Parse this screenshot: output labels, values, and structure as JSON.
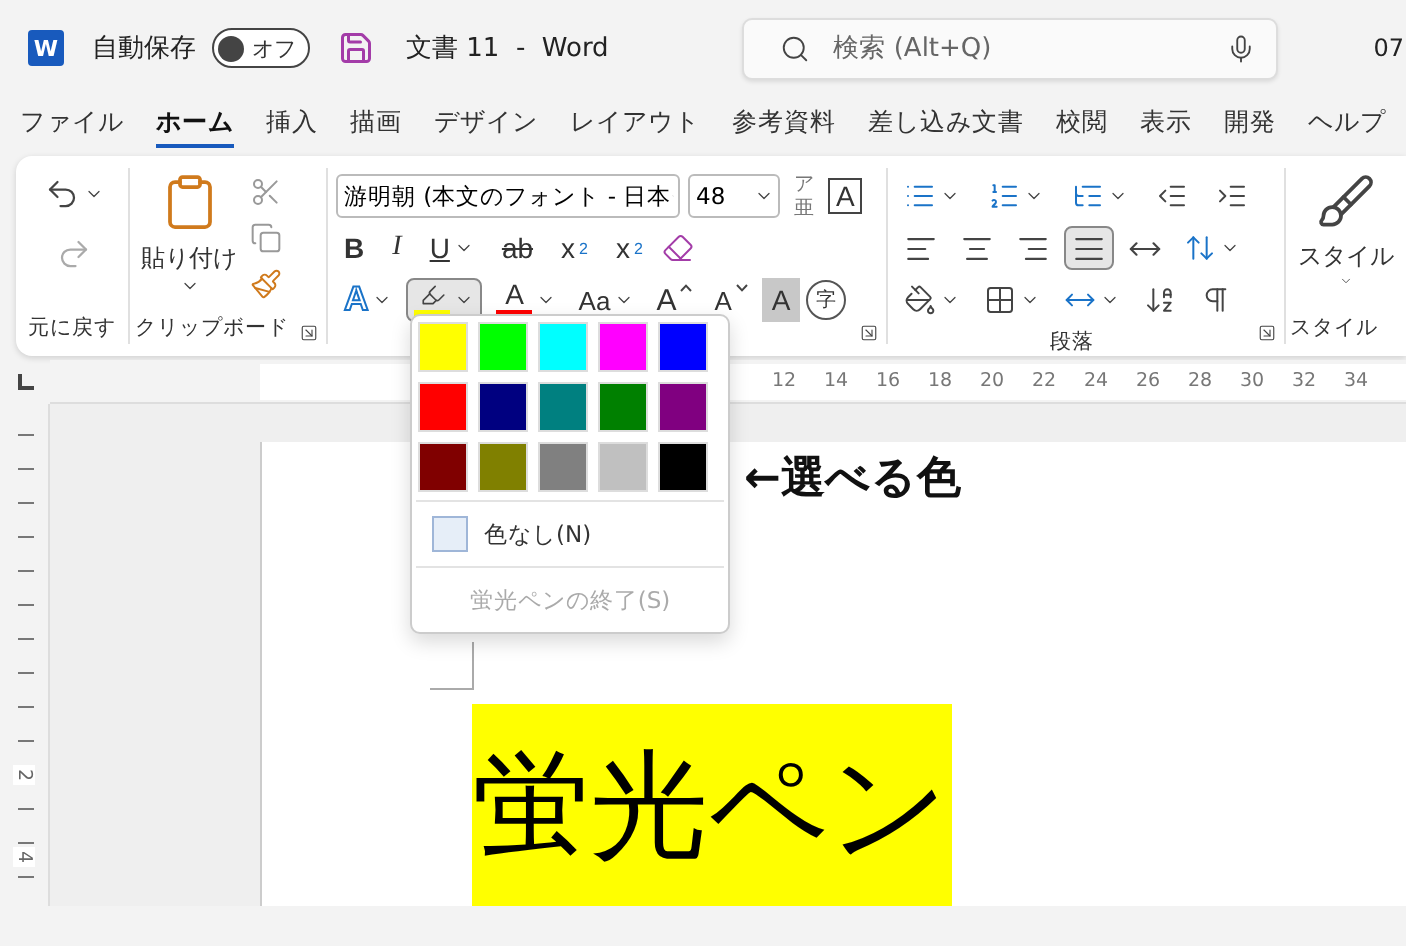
{
  "title_bar": {
    "logo_letter": "W",
    "autosave_label": "自動保存",
    "autosave_toggle": {
      "label": "オフ",
      "on": false
    },
    "document_title": "文書 11  -  Word",
    "search": {
      "placeholder": "検索 (Alt+Q)"
    },
    "clipped_text": "07"
  },
  "menu_tabs": [
    {
      "label": "ファイル",
      "selected": false
    },
    {
      "label": "ホーム",
      "selected": true
    },
    {
      "label": "挿入",
      "selected": false
    },
    {
      "label": "描画",
      "selected": false
    },
    {
      "label": "デザイン",
      "selected": false
    },
    {
      "label": "レイアウト",
      "selected": false
    },
    {
      "label": "参考資料",
      "selected": false
    },
    {
      "label": "差し込み文書",
      "selected": false
    },
    {
      "label": "校閲",
      "selected": false
    },
    {
      "label": "表示",
      "selected": false
    },
    {
      "label": "開発",
      "selected": false
    },
    {
      "label": "ヘルプ",
      "selected": false
    }
  ],
  "ribbon": {
    "undo_group": {
      "label": "元に戻す"
    },
    "clipboard_group": {
      "label": "クリップボード",
      "paste_label": "貼り付け"
    },
    "font_group": {
      "font_name": "游明朝 (本文のフォント - 日本",
      "font_size": "48",
      "phonetic_guide": {
        "top": "ア",
        "bottom": "亜"
      },
      "border_letter": "A",
      "format_buttons": [
        {
          "kind": "bold",
          "label": "B"
        },
        {
          "kind": "italic",
          "label": "I"
        },
        {
          "kind": "underline",
          "label": "U"
        },
        {
          "kind": "strike",
          "label": "ab"
        },
        {
          "kind": "sub",
          "label": "x",
          "mark": "2"
        },
        {
          "kind": "sup",
          "label": "x",
          "mark": "2"
        }
      ],
      "effect_buttons": [
        {
          "kind": "effect",
          "label": "A"
        },
        {
          "kind": "highlight",
          "pressed": true,
          "color": "#ffff00"
        },
        {
          "kind": "color",
          "label": "A",
          "color": "#ff0000"
        },
        {
          "kind": "case",
          "label": "Aa"
        },
        {
          "kind": "grow",
          "label": "A"
        },
        {
          "kind": "shrink",
          "label": "A"
        },
        {
          "kind": "shade",
          "label": "A"
        },
        {
          "kind": "enclose",
          "label": "字"
        }
      ]
    },
    "paragraph_group": {
      "label": "段落",
      "alignments": [
        {
          "selected": false
        },
        {
          "selected": false
        },
        {
          "selected": false
        },
        {
          "selected": true
        },
        {
          "selected": false
        }
      ]
    },
    "style_group": {
      "button_label": "スタイル",
      "label": "スタイル"
    }
  },
  "ruler": {
    "labels": [
      "12",
      "14",
      "16",
      "18",
      "20",
      "22",
      "24",
      "26",
      "28",
      "30",
      "32",
      "34"
    ],
    "vertical_labels": [
      "2",
      "4"
    ]
  },
  "highlight_menu": {
    "colors": [
      {
        "color": "#ffff00"
      },
      {
        "color": "#00ff00"
      },
      {
        "color": "#00ffff"
      },
      {
        "color": "#ff00ff"
      },
      {
        "color": "#0000ff"
      },
      {
        "color": "#ff0000"
      },
      {
        "color": "#000080"
      },
      {
        "color": "#008080"
      },
      {
        "color": "#008000"
      },
      {
        "color": "#800080"
      },
      {
        "color": "#800000"
      },
      {
        "color": "#808000"
      },
      {
        "color": "#808080"
      },
      {
        "color": "#c0c0c0"
      },
      {
        "color": "#000000"
      }
    ],
    "no_color": "色なし(N)",
    "stop": {
      "label": "蛍光ペンの終了(S)",
      "disabled": true
    }
  },
  "document": {
    "text": "蛍光ペン",
    "annotation": "←選べる色"
  }
}
